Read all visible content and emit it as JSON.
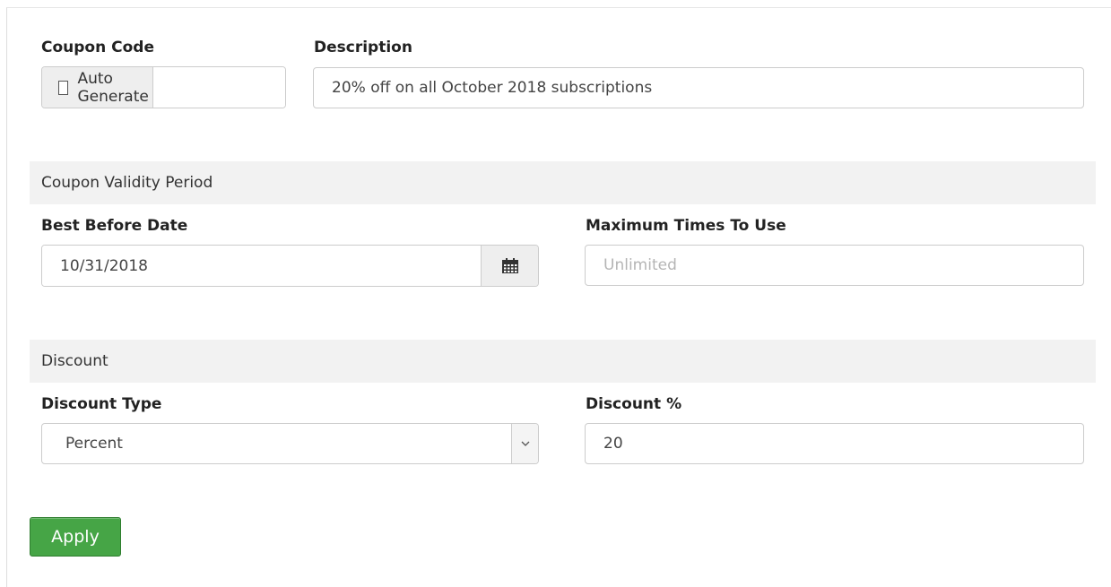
{
  "colors": {
    "section_background": "#f2f2f2",
    "input_border": "#cccccc",
    "addon_background": "#eeeeee",
    "apply_button": "#46a546",
    "apply_button_border": "#2f7d2f"
  },
  "coupon_code": {
    "label": "Coupon Code",
    "auto_generate": {
      "label": "Auto Generate",
      "checked": false
    },
    "value": ""
  },
  "description": {
    "label": "Description",
    "value": "20% off on all October 2018 subscriptions"
  },
  "validity_section": {
    "title": "Coupon Validity Period",
    "best_before": {
      "label": "Best Before Date",
      "value": "10/31/2018",
      "icon": "calendar-icon"
    },
    "max_uses": {
      "label": "Maximum Times To Use",
      "value": "",
      "placeholder": "Unlimited"
    }
  },
  "discount_section": {
    "title": "Discount",
    "type": {
      "label": "Discount Type",
      "selected": "Percent",
      "icon": "chevron-down-icon"
    },
    "percent": {
      "label": "Discount %",
      "value": "20"
    }
  },
  "actions": {
    "apply_label": "Apply"
  }
}
